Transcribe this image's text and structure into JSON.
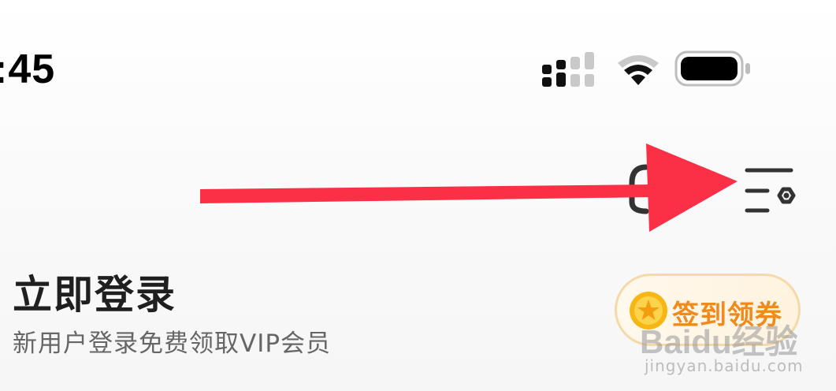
{
  "status_bar": {
    "time": ":45",
    "icons": [
      "signal-icon",
      "wifi-icon",
      "battery-icon"
    ]
  },
  "header": {
    "icons": [
      "customer-service-icon",
      "settings-icon"
    ]
  },
  "annotation": {
    "arrow_color": "#fb2f45"
  },
  "login": {
    "title": "立即登录",
    "subtitle": "新用户登录免费领取VIP会员"
  },
  "checkin": {
    "label": "签到领券",
    "accent_color": "#f08a1a"
  },
  "watermark": {
    "logo_text": "Baidu经验",
    "url": "jingyan.baidu.com"
  }
}
